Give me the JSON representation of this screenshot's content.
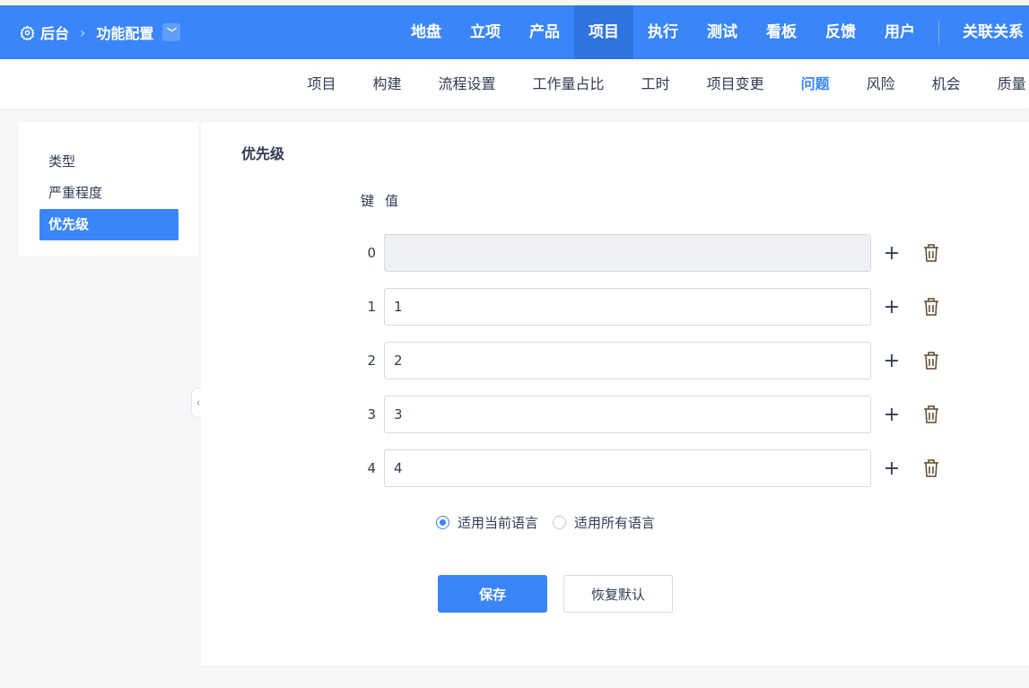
{
  "breadcrumb": {
    "root": "后台",
    "current": "功能配置"
  },
  "main_nav": [
    {
      "label": "地盘"
    },
    {
      "label": "立项"
    },
    {
      "label": "产品"
    },
    {
      "label": "项目",
      "active": true
    },
    {
      "label": "执行"
    },
    {
      "label": "测试"
    },
    {
      "label": "看板"
    },
    {
      "label": "反馈"
    },
    {
      "label": "用户"
    },
    {
      "label": "关联关系"
    }
  ],
  "sub_nav": [
    {
      "label": "项目"
    },
    {
      "label": "构建"
    },
    {
      "label": "流程设置"
    },
    {
      "label": "工作量占比"
    },
    {
      "label": "工时"
    },
    {
      "label": "项目变更"
    },
    {
      "label": "问题",
      "active": true
    },
    {
      "label": "风险"
    },
    {
      "label": "机会"
    },
    {
      "label": "质量"
    }
  ],
  "sidebar": [
    {
      "label": "类型"
    },
    {
      "label": "严重程度"
    },
    {
      "label": "优先级",
      "active": true
    }
  ],
  "section_title": "优先级",
  "headers": {
    "key": "键",
    "value": "值"
  },
  "rows": [
    {
      "key": "0",
      "value": ""
    },
    {
      "key": "1",
      "value": "1"
    },
    {
      "key": "2",
      "value": "2"
    },
    {
      "key": "3",
      "value": "3"
    },
    {
      "key": "4",
      "value": "4"
    }
  ],
  "lang_options": {
    "current": "适用当前语言",
    "all": "适用所有语言",
    "selected": "current"
  },
  "buttons": {
    "save": "保存",
    "reset": "恢复默认"
  },
  "colors": {
    "primary": "#3a86f8"
  }
}
